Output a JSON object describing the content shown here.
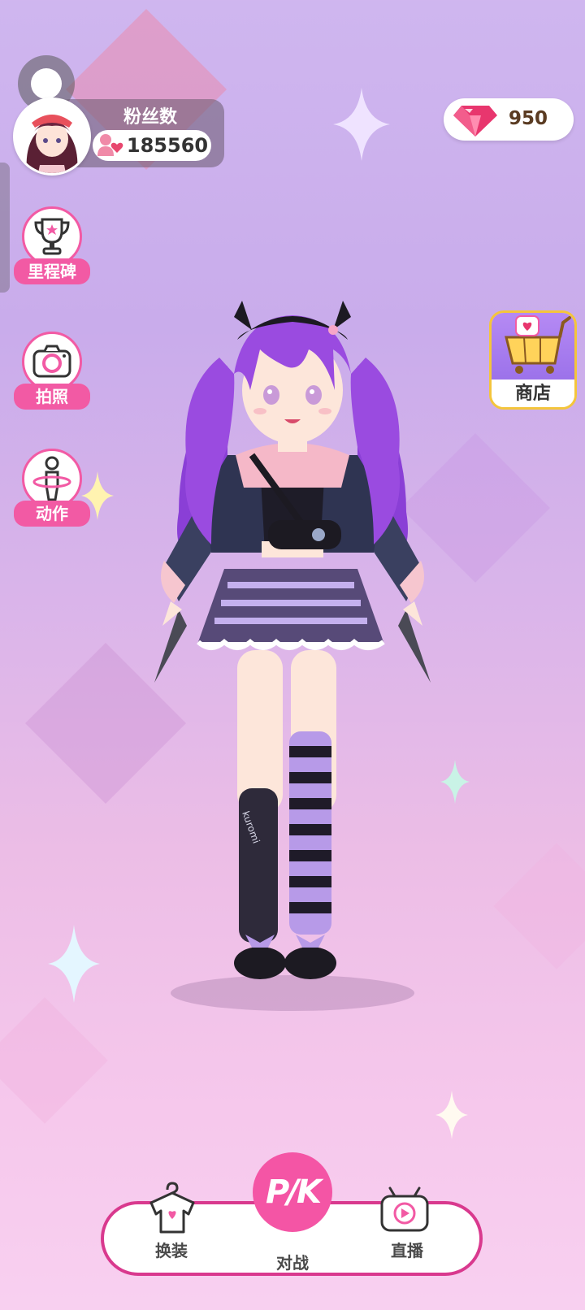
{
  "profile": {
    "fans_label": "粉丝数",
    "fans_count": "185560"
  },
  "currency": {
    "gems": "950"
  },
  "side_menu": [
    {
      "label": "里程碑",
      "icon": "trophy-icon"
    },
    {
      "label": "拍照",
      "icon": "camera-icon"
    },
    {
      "label": "动作",
      "icon": "pose-figure-icon"
    }
  ],
  "shop": {
    "label": "商店",
    "icon": "shopping-cart-icon"
  },
  "bottom_nav": {
    "dress_up": "换装",
    "battle": "对战",
    "live": "直播",
    "pk_text": "P/K"
  },
  "character": {
    "sock_text": "kuromi"
  },
  "colors": {
    "accent_pink": "#f25aa4",
    "nav_border": "#d9398e",
    "shop_border": "#f4c53c",
    "gem": "#e8366e"
  }
}
